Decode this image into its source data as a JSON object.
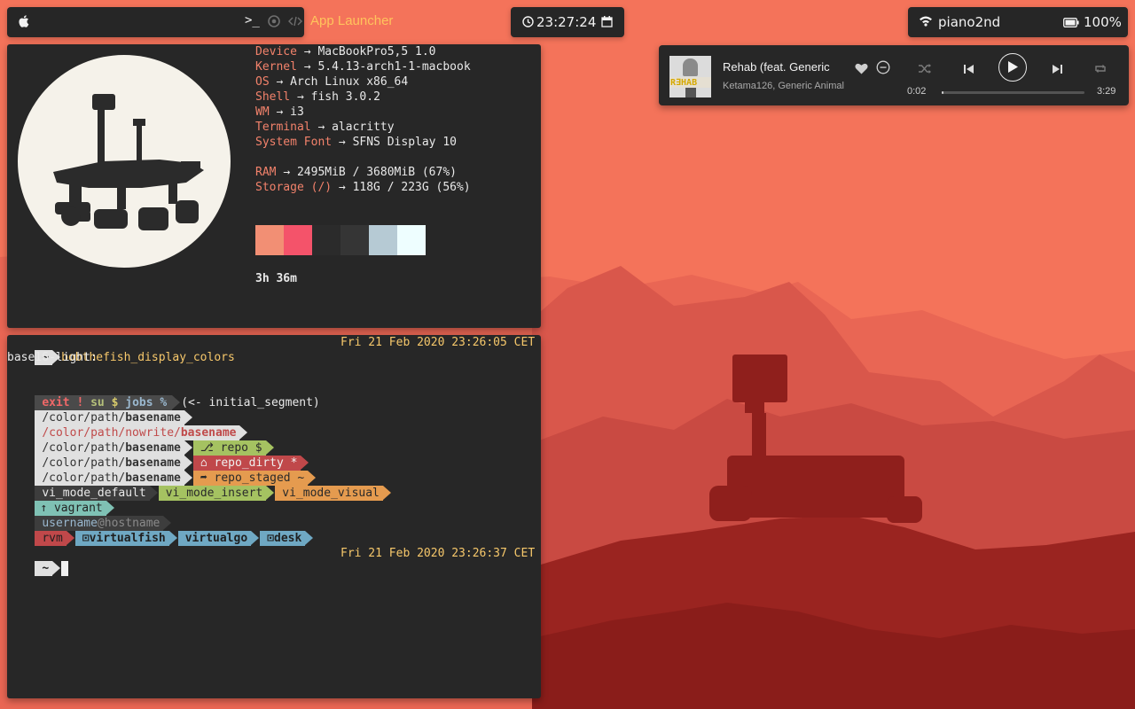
{
  "topbar": {
    "apps": {
      "apple_icon": "apple-icon",
      "terminal_icon": "terminal-icon",
      "terminal_glyph": ">_",
      "browser_icon": "chrome-icon",
      "code_icon": "code-icon"
    },
    "launcher_label": "App Launcher",
    "clock": "23:27:24",
    "network": "piano2nd",
    "battery": "100%"
  },
  "player": {
    "album_text": "R∃HAB",
    "title": "Rehab (feat. Generic",
    "artist": "Ketama126, Generic Animal",
    "elapsed": "0:02",
    "total": "3:29",
    "progress": 0.01
  },
  "neofetch": {
    "rows": [
      {
        "key": "Device",
        "value": "MacBookPro5,5 1.0"
      },
      {
        "key": "Kernel",
        "value": "5.4.13-arch1-1-macbook"
      },
      {
        "key": "OS",
        "value": "Arch Linux x86_64"
      },
      {
        "key": "Shell",
        "value": "fish 3.0.2"
      },
      {
        "key": "WM",
        "value": "i3"
      },
      {
        "key": "Terminal",
        "value": "alacritty"
      },
      {
        "key": "System Font",
        "value": "SFNS Display 10"
      },
      {
        "key": "RAM",
        "value": "2495MiB / 3680MiB (67%)"
      },
      {
        "key": "Storage (/)",
        "value": "118G / 223G (56%)"
      }
    ],
    "arrow": "→",
    "swatches": [
      "#f28f74",
      "#f4536a",
      "#2b2b2b",
      "#353535",
      "#b6cad4",
      "#eefeff"
    ],
    "uptime": "3h 36m"
  },
  "terminal": {
    "prompt1": {
      "dir": "~",
      "cmd": "bobthefish_display_colors",
      "time": "Fri 21 Feb 2020 23:26:05 CET"
    },
    "output_header": "base16-light:",
    "status": {
      "exit": "exit",
      "bang": "!",
      "su": "su",
      "dollar": "$",
      "jobs": "jobs",
      "percent": "%",
      "note": "(<- initial_segment)"
    },
    "path_prefix": "/color/path/",
    "path_prefix_nowrite": "/color/path/nowrite/",
    "basename": "basename",
    "repo": "⎇ repo $",
    "repo_dirty": "⌂ repo_dirty *",
    "repo_staged": "➦ repo_staged ~",
    "vi_modes": [
      "vi_mode_default",
      "vi_mode_insert",
      "vi_mode_visual"
    ],
    "vagrant": "↑ vagrant",
    "user": "username",
    "host": "@hostname",
    "envs": [
      "rvm",
      "⊡virtualfish",
      "virtualgo",
      "⊡desk"
    ],
    "prompt2": {
      "dir": "~",
      "time": "Fri 21 Feb 2020 23:26:37 CET"
    }
  },
  "colors": {
    "sky": "#f4735a",
    "accent_orange": "#f2826b",
    "accent_yellow": "#f7c86b",
    "panel": "#272727"
  }
}
